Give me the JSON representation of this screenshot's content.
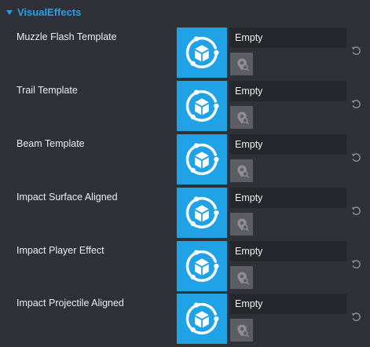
{
  "section": {
    "title": "VisualEffects",
    "icon": "caret-down-icon"
  },
  "colors": {
    "accent": "#20a3e8",
    "background": "#2f3138",
    "field": "#25272d",
    "picker": "#5b5d63"
  },
  "properties": [
    {
      "label": "Muzzle Flash Template",
      "value": "Empty"
    },
    {
      "label": "Trail Template",
      "value": "Empty"
    },
    {
      "label": "Beam Template",
      "value": "Empty"
    },
    {
      "label": "Impact Surface Aligned",
      "value": "Empty"
    },
    {
      "label": "Impact Player Effect",
      "value": "Empty"
    },
    {
      "label": "Impact Projectile Aligned",
      "value": "Empty"
    }
  ],
  "icons": {
    "thumbnail": "template-asset-icon",
    "picker": "asset-picker-icon",
    "reset": "reset-icon"
  }
}
